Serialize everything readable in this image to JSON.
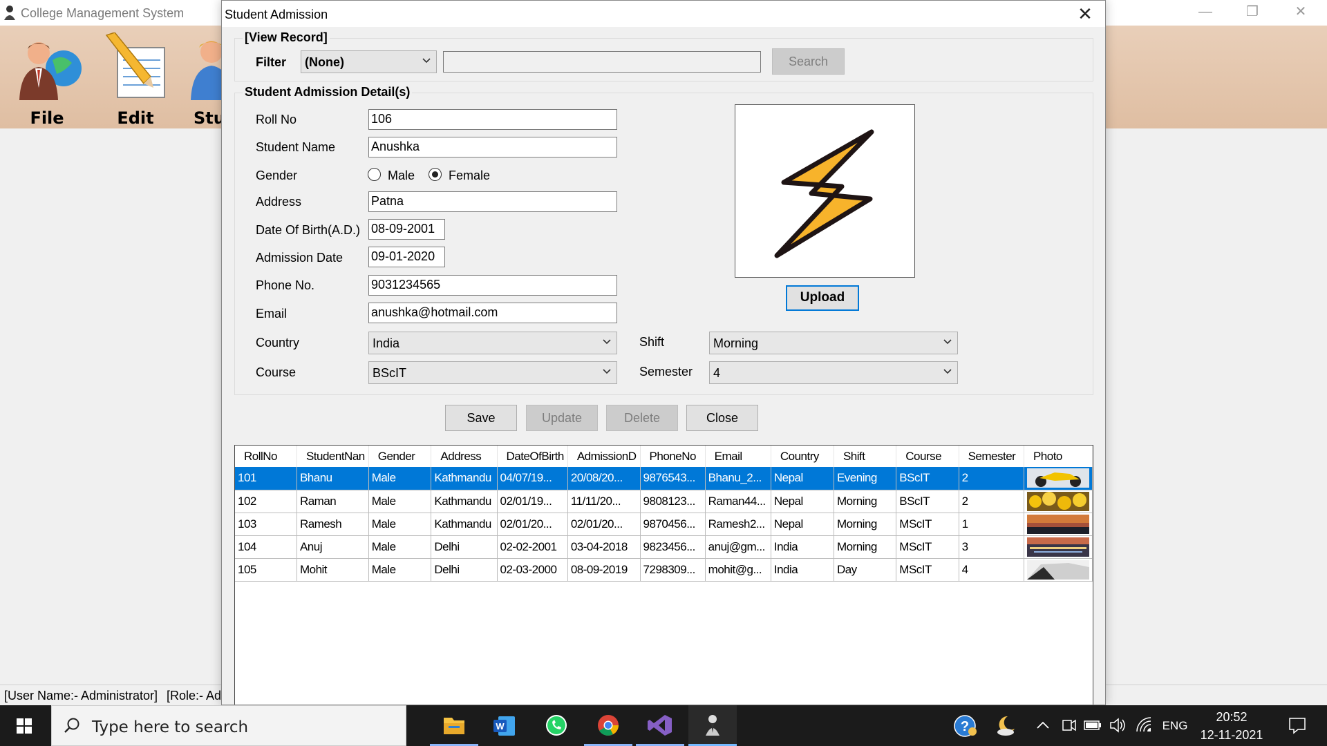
{
  "main_window": {
    "title": "College Management System",
    "toolbar": [
      {
        "label": "File",
        "icon": "businessman-globe-icon"
      },
      {
        "label": "Edit",
        "icon": "notepad-pencil-icon"
      },
      {
        "label": "Stu",
        "icon": "student-icon"
      }
    ],
    "status": {
      "user": "[User Name:- Administrator]",
      "role": "[Role:- Ad"
    }
  },
  "dialog": {
    "title": "Student Admission",
    "view_record": {
      "legend": "[View Record]",
      "filter_label": "Filter",
      "filter_value": "(None)",
      "search_text": "",
      "search_button": "Search"
    },
    "details": {
      "legend": "Student Admission Detail(s)",
      "roll_no": {
        "label": "Roll No",
        "value": "106"
      },
      "student_name": {
        "label": "Student Name",
        "value": "Anushka"
      },
      "gender": {
        "label": "Gender",
        "options": [
          "Male",
          "Female"
        ],
        "selected": "Female"
      },
      "address": {
        "label": "Address",
        "value": "Patna"
      },
      "dob": {
        "label": "Date Of Birth(A.D.)",
        "value": "08-09-2001"
      },
      "admission_date": {
        "label": "Admission Date",
        "value": "09-01-2020"
      },
      "phone": {
        "label": "Phone No.",
        "value": "9031234565"
      },
      "email": {
        "label": "Email",
        "value": "anushka@hotmail.com"
      },
      "country": {
        "label": "Country",
        "value": "India"
      },
      "course": {
        "label": "Course",
        "value": "BScIT"
      },
      "shift": {
        "label": "Shift",
        "value": "Morning"
      },
      "semester": {
        "label": "Semester",
        "value": "4"
      },
      "upload_button": "Upload",
      "photo_icon": "lightning-bolt-icon"
    },
    "actions": {
      "save": "Save",
      "update": "Update",
      "delete": "Delete",
      "close": "Close"
    },
    "grid": {
      "columns": [
        "RollNo",
        "StudentNan",
        "Gender",
        "Address",
        "DateOfBirth",
        "AdmissionD",
        "PhoneNo",
        "Email",
        "Country",
        "Shift",
        "Course",
        "Semester",
        "Photo"
      ],
      "rows": [
        [
          "101",
          "Bhanu",
          "Male",
          "Kathmandu",
          "04/07/19...",
          "20/08/20...",
          "9876543...",
          "Bhanu_2...",
          "Nepal",
          "Evening",
          "BScIT",
          "2"
        ],
        [
          "102",
          "Raman",
          "Male",
          "Kathmandu",
          "02/01/19...",
          "11/11/20...",
          "9808123...",
          "Raman44...",
          "Nepal",
          "Morning",
          "BScIT",
          "2"
        ],
        [
          "103",
          "Ramesh",
          "Male",
          "Kathmandu",
          "02/01/20...",
          "02/01/20...",
          "9870456...",
          "Ramesh2...",
          "Nepal",
          "Morning",
          "MScIT",
          "1"
        ],
        [
          "104",
          "Anuj",
          "Male",
          "Delhi",
          "02-02-2001",
          "03-04-2018",
          "9823456...",
          "anuj@gm...",
          "India",
          "Morning",
          "MScIT",
          "3"
        ],
        [
          "105",
          "Mohit",
          "Male",
          "Delhi",
          "02-03-2000",
          "08-09-2019",
          "7298309...",
          "mohit@g...",
          "India",
          "Day",
          "MScIT",
          "4"
        ]
      ],
      "selected_row": 0,
      "photo_thumbs": [
        "motorcycle-photo",
        "yellow-flowers-photo",
        "sunset-photo",
        "city-night-photo",
        "car-photo"
      ]
    }
  },
  "taskbar": {
    "search_placeholder": "Type here to search",
    "apps": [
      "file-explorer-icon",
      "word-icon",
      "whatsapp-icon",
      "chrome-icon",
      "visual-studio-icon",
      "college-app-icon"
    ],
    "language": "ENG",
    "time": "20:52",
    "date": "12-11-2021"
  },
  "colors": {
    "selection": "#0078d7",
    "toolbar_bg": "#e4c6ad",
    "taskbar_bg": "#1b1b1b"
  }
}
